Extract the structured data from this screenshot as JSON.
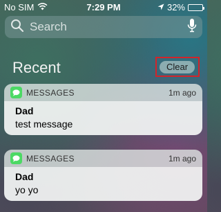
{
  "status_bar": {
    "carrier": "No SIM",
    "time": "7:29 PM",
    "battery_percent": "32%",
    "battery_level": 0.32,
    "icons": [
      "wifi-icon",
      "location-arrow-icon",
      "battery-icon"
    ]
  },
  "search": {
    "placeholder": "Search",
    "icons": [
      "search-icon",
      "microphone-icon"
    ]
  },
  "recent": {
    "title": "Recent",
    "clear_label": "Clear",
    "highlight_color": "#d2242a"
  },
  "notifications": [
    {
      "app": "MESSAGES",
      "time": "1m ago",
      "sender": "Dad",
      "message": "test message",
      "icon": "messages-icon"
    },
    {
      "app": "MESSAGES",
      "time": "1m ago",
      "sender": "Dad",
      "message": "yo yo",
      "icon": "messages-icon"
    }
  ],
  "colors": {
    "messages_green": "#4cd964",
    "clear_button_bg": "#aac3c3"
  }
}
